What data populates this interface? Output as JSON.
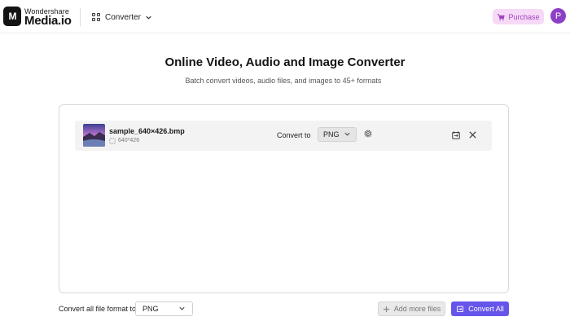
{
  "header": {
    "brand_small": "Wondershare",
    "brand_big": "Media.io",
    "logo_mark": "M",
    "nav_label": "Converter",
    "purchase_label": "Purchase",
    "avatar_initial": "P"
  },
  "hero": {
    "title": "Online Video, Audio and Image Converter",
    "subtitle": "Batch convert videos, audio files, and images to 45+ formats"
  },
  "files": [
    {
      "name": "sample_640×426.bmp",
      "size": "640*426",
      "convert_to_label": "Convert to",
      "format": "PNG"
    }
  ],
  "footer": {
    "convert_all_label": "Convert all file format to:",
    "convert_all_format": "PNG",
    "add_more_label": "Add more files",
    "convert_all_button": "Convert All"
  },
  "colors": {
    "accent": "#6655ea",
    "purchase_bg": "#f6d9f6",
    "purchase_text": "#a144c4",
    "avatar": "#8d3fc6"
  },
  "icons": {
    "nav": "grid-icon",
    "purchase": "cart-icon",
    "settings": "gear-icon",
    "row_convert": "convert-icon",
    "row_close": "close-icon",
    "add": "plus-icon",
    "convert_all": "convert-icon"
  }
}
